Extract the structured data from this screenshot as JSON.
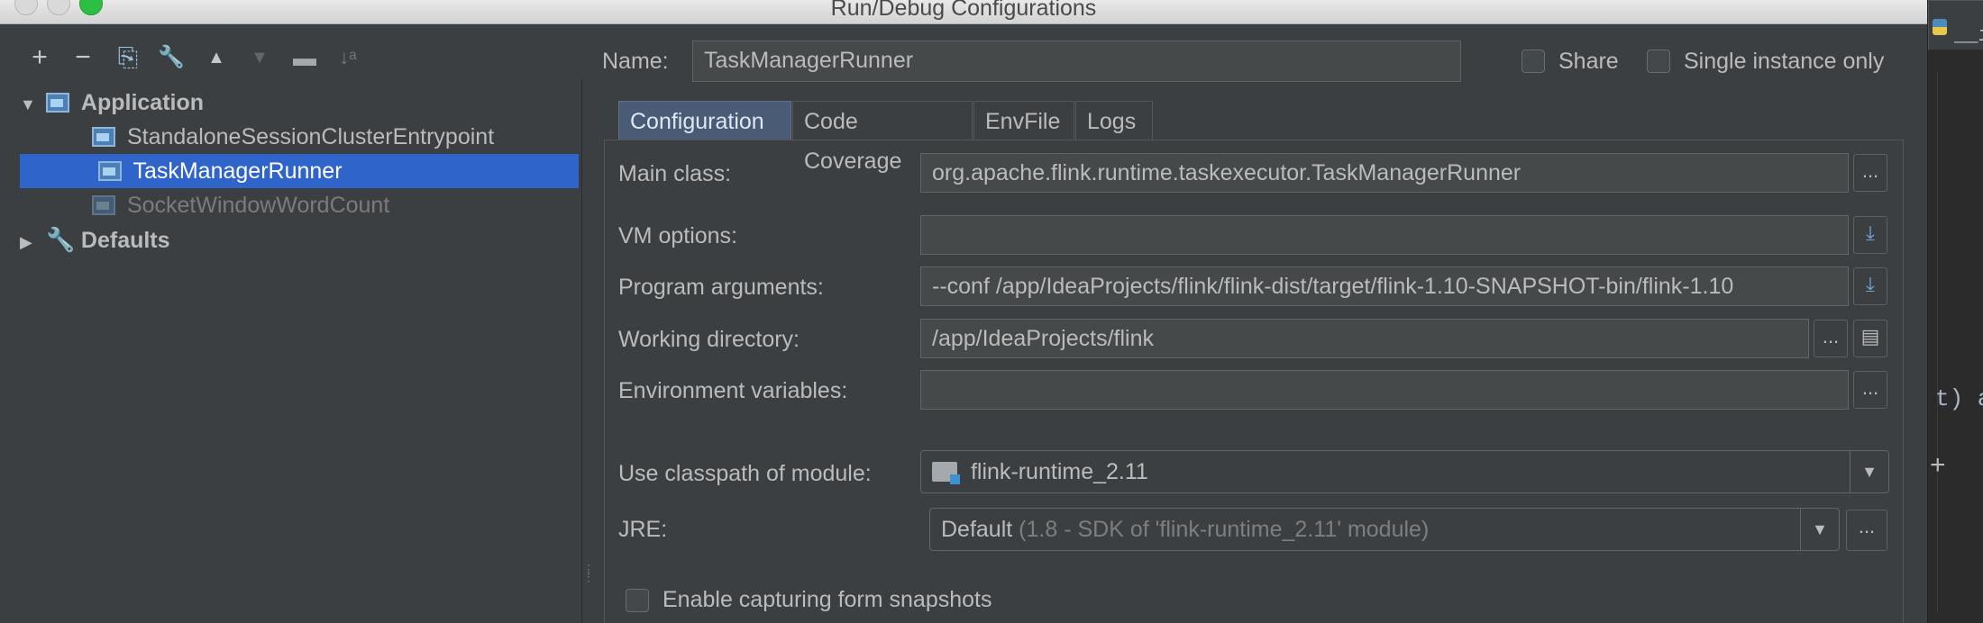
{
  "window": {
    "title": "Run/Debug Configurations"
  },
  "toolbar": {
    "buttons": [
      {
        "icon": "plus-icon",
        "glyph": "+"
      },
      {
        "icon": "minus-icon",
        "glyph": "−"
      },
      {
        "icon": "copy-icon",
        "glyph": "⎘"
      },
      {
        "icon": "wrench-icon",
        "glyph": "🔧"
      },
      {
        "icon": "move-up-icon",
        "glyph": "▲"
      },
      {
        "icon": "move-down-icon",
        "glyph": "▼"
      },
      {
        "icon": "folder-icon",
        "glyph": "▬"
      },
      {
        "icon": "sort-icon",
        "glyph": "↓ᵃ"
      }
    ]
  },
  "tree": {
    "application": "Application",
    "items": [
      "StandaloneSessionClusterEntrypoint",
      "TaskManagerRunner",
      "SocketWindowWordCount"
    ],
    "selected": "TaskManagerRunner",
    "defaults": "Defaults"
  },
  "form": {
    "name_label": "Name:",
    "name_value": "TaskManagerRunner",
    "share_label": "Share",
    "single_instance_label": "Single instance only",
    "tabs": [
      "Configuration",
      "Code Coverage",
      "EnvFile",
      "Logs"
    ],
    "active_tab": "Configuration",
    "main_class_label": "Main class:",
    "main_class_value": "org.apache.flink.runtime.taskexecutor.TaskManagerRunner",
    "vm_options_label": "VM options:",
    "vm_options_value": "",
    "program_args_label": "Program arguments:",
    "program_args_value": "--conf /app/IdeaProjects/flink/flink-dist/target/flink-1.10-SNAPSHOT-bin/flink-1.10",
    "working_dir_label": "Working directory:",
    "working_dir_value": "/app/IdeaProjects/flink",
    "env_vars_label": "Environment variables:",
    "env_vars_value": "",
    "classpath_label": "Use classpath of module:",
    "classpath_value": "flink-runtime_2.11",
    "jre_label": "JRE:",
    "jre_value": "Default",
    "jre_detail": "(1.8 - SDK of 'flink-runtime_2.11' module)",
    "capture_label": "Enable capturing form snapshots",
    "browse_glyph": "...",
    "expand_glyph": "⤓",
    "doc_glyph": "▤"
  },
  "editor_strip": {
    "tab_label": "__ini",
    "code_fragment": "t) a",
    "plus_glyph": "+"
  },
  "colors": {
    "background": "#3c3f41",
    "selection": "#2f65ca",
    "active_tab": "#4a5b75",
    "field": "#45494a"
  }
}
